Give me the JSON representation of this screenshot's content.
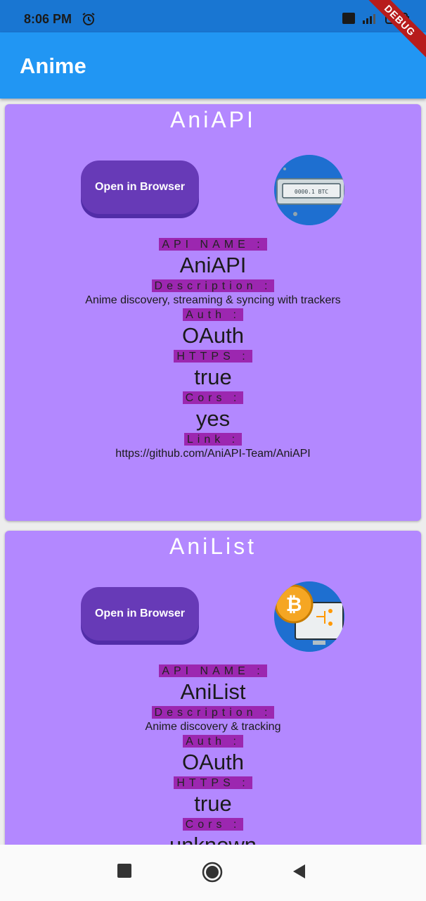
{
  "status": {
    "time": "8:06 PM"
  },
  "debug_banner": "DEBUG",
  "appbar": {
    "title": "Anime"
  },
  "labels": {
    "api_name": "API NAME :",
    "description": "Description :",
    "auth": "Auth :",
    "https": "HTTPS :",
    "cors": "Cors :",
    "link": "Link :"
  },
  "cards": [
    {
      "title": "AniAPI",
      "button": "Open in Browser",
      "api_name": "AniAPI",
      "description": "Anime discovery, streaming & syncing with trackers",
      "auth": "OAuth",
      "https": "true",
      "cors": "yes",
      "link": "https://github.com/AniAPI-Team/AniAPI",
      "logo_text": "0000.1 BTC"
    },
    {
      "title": "AniList",
      "button": "Open in Browser",
      "api_name": "AniList",
      "description": "Anime discovery & tracking",
      "auth": "OAuth",
      "https": "true",
      "cors": "unknown"
    }
  ]
}
